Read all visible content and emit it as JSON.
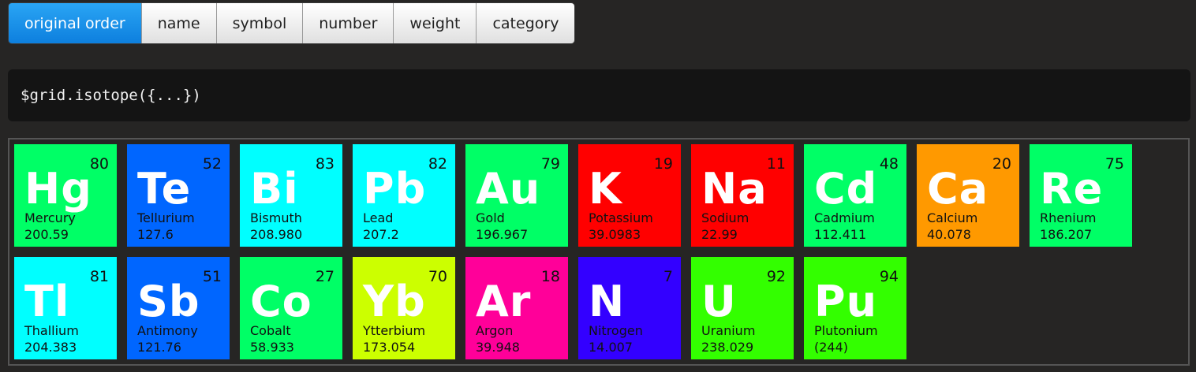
{
  "sort_buttons": [
    {
      "label": "original order",
      "active": true
    },
    {
      "label": "name",
      "active": false
    },
    {
      "label": "symbol",
      "active": false
    },
    {
      "label": "number",
      "active": false
    },
    {
      "label": "weight",
      "active": false
    },
    {
      "label": "category",
      "active": false
    }
  ],
  "code": "$grid.isotope({...})",
  "elements": [
    {
      "symbol": "Hg",
      "name": "Mercury",
      "number": "80",
      "weight": "200.59",
      "color": "#00ff66"
    },
    {
      "symbol": "Te",
      "name": "Tellurium",
      "number": "52",
      "weight": "127.6",
      "color": "#0066ff"
    },
    {
      "symbol": "Bi",
      "name": "Bismuth",
      "number": "83",
      "weight": "208.980",
      "color": "#00ffff"
    },
    {
      "symbol": "Pb",
      "name": "Lead",
      "number": "82",
      "weight": "207.2",
      "color": "#00ffff"
    },
    {
      "symbol": "Au",
      "name": "Gold",
      "number": "79",
      "weight": "196.967",
      "color": "#00ff66"
    },
    {
      "symbol": "K",
      "name": "Potassium",
      "number": "19",
      "weight": "39.0983",
      "color": "#ff0000"
    },
    {
      "symbol": "Na",
      "name": "Sodium",
      "number": "11",
      "weight": "22.99",
      "color": "#ff0000"
    },
    {
      "symbol": "Cd",
      "name": "Cadmium",
      "number": "48",
      "weight": "112.411",
      "color": "#00ff66"
    },
    {
      "symbol": "Ca",
      "name": "Calcium",
      "number": "20",
      "weight": "40.078",
      "color": "#ff9900"
    },
    {
      "symbol": "Re",
      "name": "Rhenium",
      "number": "75",
      "weight": "186.207",
      "color": "#00ff66"
    },
    {
      "symbol": "Tl",
      "name": "Thallium",
      "number": "81",
      "weight": "204.383",
      "color": "#00ffff"
    },
    {
      "symbol": "Sb",
      "name": "Antimony",
      "number": "51",
      "weight": "121.76",
      "color": "#0066ff"
    },
    {
      "symbol": "Co",
      "name": "Cobalt",
      "number": "27",
      "weight": "58.933",
      "color": "#00ff66"
    },
    {
      "symbol": "Yb",
      "name": "Ytterbium",
      "number": "70",
      "weight": "173.054",
      "color": "#ccff00"
    },
    {
      "symbol": "Ar",
      "name": "Argon",
      "number": "18",
      "weight": "39.948",
      "color": "#ff0099"
    },
    {
      "symbol": "N",
      "name": "Nitrogen",
      "number": "7",
      "weight": "14.007",
      "color": "#3300ff"
    },
    {
      "symbol": "U",
      "name": "Uranium",
      "number": "92",
      "weight": "238.029",
      "color": "#33ff00"
    },
    {
      "symbol": "Pu",
      "name": "Plutonium",
      "number": "94",
      "weight": "(244)",
      "color": "#33ff00"
    }
  ]
}
